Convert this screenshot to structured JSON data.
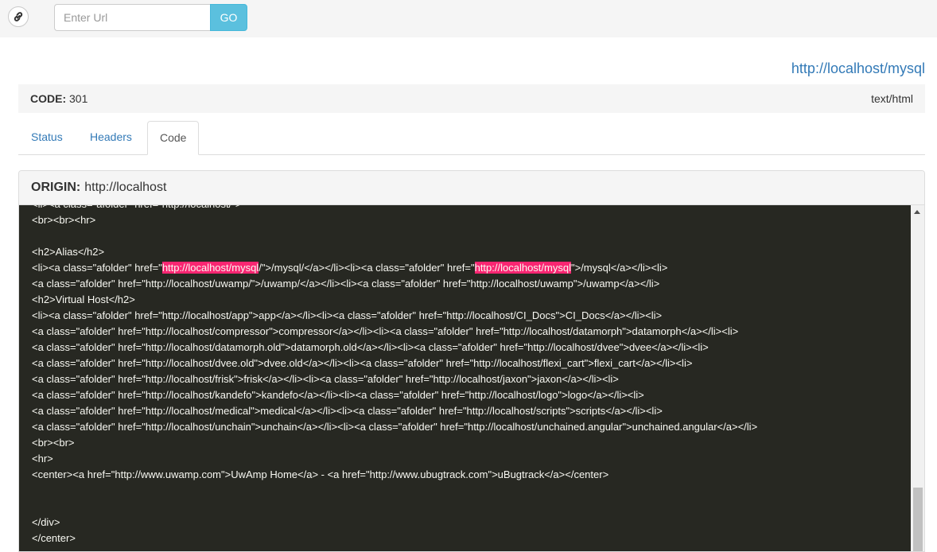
{
  "header": {
    "logo_icon": "link-icon",
    "url_placeholder": "Enter Url",
    "go_label": "GO"
  },
  "result": {
    "url": "http://localhost/mysql",
    "code_label": "CODE:",
    "code_value": "301",
    "content_type": "text/html"
  },
  "tabs": [
    {
      "label": "Status",
      "active": false
    },
    {
      "label": "Headers",
      "active": false
    },
    {
      "label": "Code",
      "active": true
    }
  ],
  "panel": {
    "origin_label": "ORIGIN:",
    "origin_value": "http://localhost"
  },
  "code": {
    "highlight": "http://localhost/mysql",
    "highlight_color": "#f92672",
    "background": "#272822",
    "lines": [
      "<li><a class=\"afolder\" href=\"http://localhost/\">",
      "<br><br><hr>",
      "",
      "<h2>Alias</h2>",
      "<li><a class=\"afolder\" href=\"http://localhost/mysql/\">/mysql/</a></li><li><a class=\"afolder\" href=\"http://localhost/mysql\">/mysql</a></li><li>",
      "<a class=\"afolder\" href=\"http://localhost/uwamp/\">/uwamp/</a></li><li><a class=\"afolder\" href=\"http://localhost/uwamp\">/uwamp</a></li>",
      "<h2>Virtual Host</h2>",
      "<li><a class=\"afolder\" href=\"http://localhost/app\">app</a></li><li><a class=\"afolder\" href=\"http://localhost/CI_Docs\">CI_Docs</a></li><li>",
      "<a class=\"afolder\" href=\"http://localhost/compressor\">compressor</a></li><li><a class=\"afolder\" href=\"http://localhost/datamorph\">datamorph</a></li><li>",
      "<a class=\"afolder\" href=\"http://localhost/datamorph.old\">datamorph.old</a></li><li><a class=\"afolder\" href=\"http://localhost/dvee\">dvee</a></li><li>",
      "<a class=\"afolder\" href=\"http://localhost/dvee.old\">dvee.old</a></li><li><a class=\"afolder\" href=\"http://localhost/flexi_cart\">flexi_cart</a></li><li>",
      "<a class=\"afolder\" href=\"http://localhost/frisk\">frisk</a></li><li><a class=\"afolder\" href=\"http://localhost/jaxon\">jaxon</a></li><li>",
      "<a class=\"afolder\" href=\"http://localhost/kandefo\">kandefo</a></li><li><a class=\"afolder\" href=\"http://localhost/logo\">logo</a></li><li>",
      "<a class=\"afolder\" href=\"http://localhost/medical\">medical</a></li><li><a class=\"afolder\" href=\"http://localhost/scripts\">scripts</a></li><li>",
      "<a class=\"afolder\" href=\"http://localhost/unchain\">unchain</a></li><li><a class=\"afolder\" href=\"http://localhost/unchained.angular\">unchained.angular</a></li>",
      "<br><br>",
      "<hr>",
      "<center><a href=\"http://www.uwamp.com\">UwAmp Home</a> - <a href=\"http://www.ubugtrack.com\">uBugtrack</a></center>",
      "",
      "",
      "</div>",
      "</center>"
    ]
  }
}
